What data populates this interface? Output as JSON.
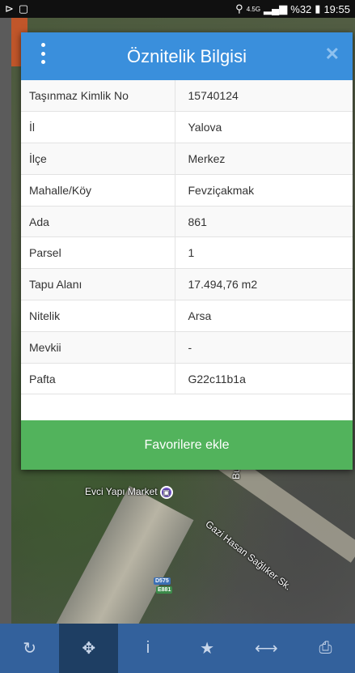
{
  "status_bar": {
    "network": "4.5G",
    "battery": "%32",
    "time": "19:55"
  },
  "map": {
    "labels": {
      "market": "Evci Yapı Market",
      "street": "Gazi Hasan Sağlıker Sk.",
      "bursa": "Burs",
      "road_d575": "D575",
      "road_e881": "E881"
    }
  },
  "modal": {
    "title": "Öznitelik Bilgisi",
    "rows": [
      {
        "key": "Taşınmaz Kimlik No",
        "value": "15740124"
      },
      {
        "key": "İl",
        "value": "Yalova"
      },
      {
        "key": "İlçe",
        "value": "Merkez"
      },
      {
        "key": "Mahalle/Köy",
        "value": "Fevziçakmak"
      },
      {
        "key": "Ada",
        "value": "861"
      },
      {
        "key": "Parsel",
        "value": "1"
      },
      {
        "key": "Tapu Alanı",
        "value": "17.494,76 m2"
      },
      {
        "key": "Nitelik",
        "value": "Arsa"
      },
      {
        "key": "Mevkii",
        "value": "-"
      },
      {
        "key": "Pafta",
        "value": "G22c11b1a"
      }
    ],
    "favorite_button": "Favorilere ekle"
  },
  "toolbar": {
    "items": [
      {
        "icon": "refresh-icon",
        "glyph": "↻",
        "active": false
      },
      {
        "icon": "locate-icon",
        "glyph": "✥",
        "active": true
      },
      {
        "icon": "info-icon",
        "glyph": "i",
        "active": false
      },
      {
        "icon": "star-icon",
        "glyph": "★",
        "active": false
      },
      {
        "icon": "measure-icon",
        "glyph": "⟷",
        "active": false
      },
      {
        "icon": "print-icon",
        "glyph": "⎙",
        "active": false
      }
    ]
  },
  "colors": {
    "header": "#3a8fdc",
    "button": "#52b35c",
    "toolbar": "#33619c"
  }
}
